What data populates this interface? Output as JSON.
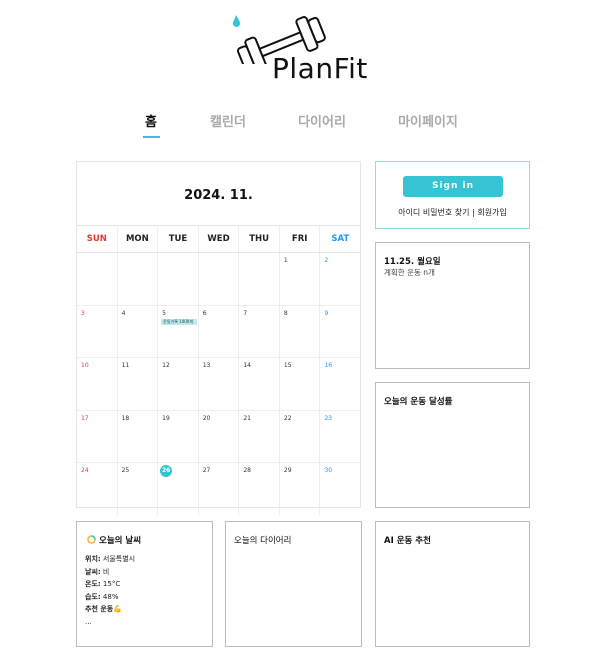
{
  "brand": {
    "name": "PlanFit"
  },
  "nav": {
    "items": [
      {
        "label": "홈",
        "active": true
      },
      {
        "label": "캘린더",
        "active": false
      },
      {
        "label": "다이어리",
        "active": false
      },
      {
        "label": "마이페이지",
        "active": false
      }
    ]
  },
  "calendar": {
    "title": "2024. 11.",
    "weekdays": [
      "SUN",
      "MON",
      "TUE",
      "WED",
      "THU",
      "FRI",
      "SAT"
    ],
    "weeks": [
      [
        "",
        "",
        "",
        "",
        "",
        "1",
        "2"
      ],
      [
        "3",
        "4",
        "5",
        "6",
        "7",
        "8",
        "9"
      ],
      [
        "10",
        "11",
        "12",
        "13",
        "14",
        "15",
        "16"
      ],
      [
        "17",
        "18",
        "19",
        "20",
        "21",
        "22",
        "23"
      ],
      [
        "24",
        "25",
        "26",
        "27",
        "28",
        "29",
        "30"
      ]
    ],
    "today": "26",
    "event": {
      "day": "5",
      "text": "운동기록 1000개"
    }
  },
  "signin": {
    "button": "Sign in",
    "find_link": "아이디 비밀번호 찾기",
    "separator": "|",
    "register_link": "회원가입"
  },
  "plan_panel": {
    "date": "11.25. 월요일",
    "text": "계획한 운동 n개"
  },
  "achievement_panel": {
    "title": "오늘의 운동 달성률"
  },
  "weather_panel": {
    "title": "오늘의 날씨",
    "lines": [
      {
        "label": "위치:",
        "value": " 서울특별시"
      },
      {
        "label": "날씨:",
        "value": " 비"
      },
      {
        "label": "온도:",
        "value": " 15°C"
      },
      {
        "label": "습도:",
        "value": " 48%"
      },
      {
        "label": "추천 운동",
        "value": "💪"
      },
      {
        "label": "",
        "value": "..."
      }
    ]
  },
  "diary_panel": {
    "title": "오늘의 다이어리"
  },
  "ai_panel": {
    "title": "AI 운동 추천"
  },
  "colors": {
    "accent": "#36c3d4",
    "sunday": "#e53935",
    "saturday": "#2196f3",
    "event": "#b9ecf1"
  }
}
